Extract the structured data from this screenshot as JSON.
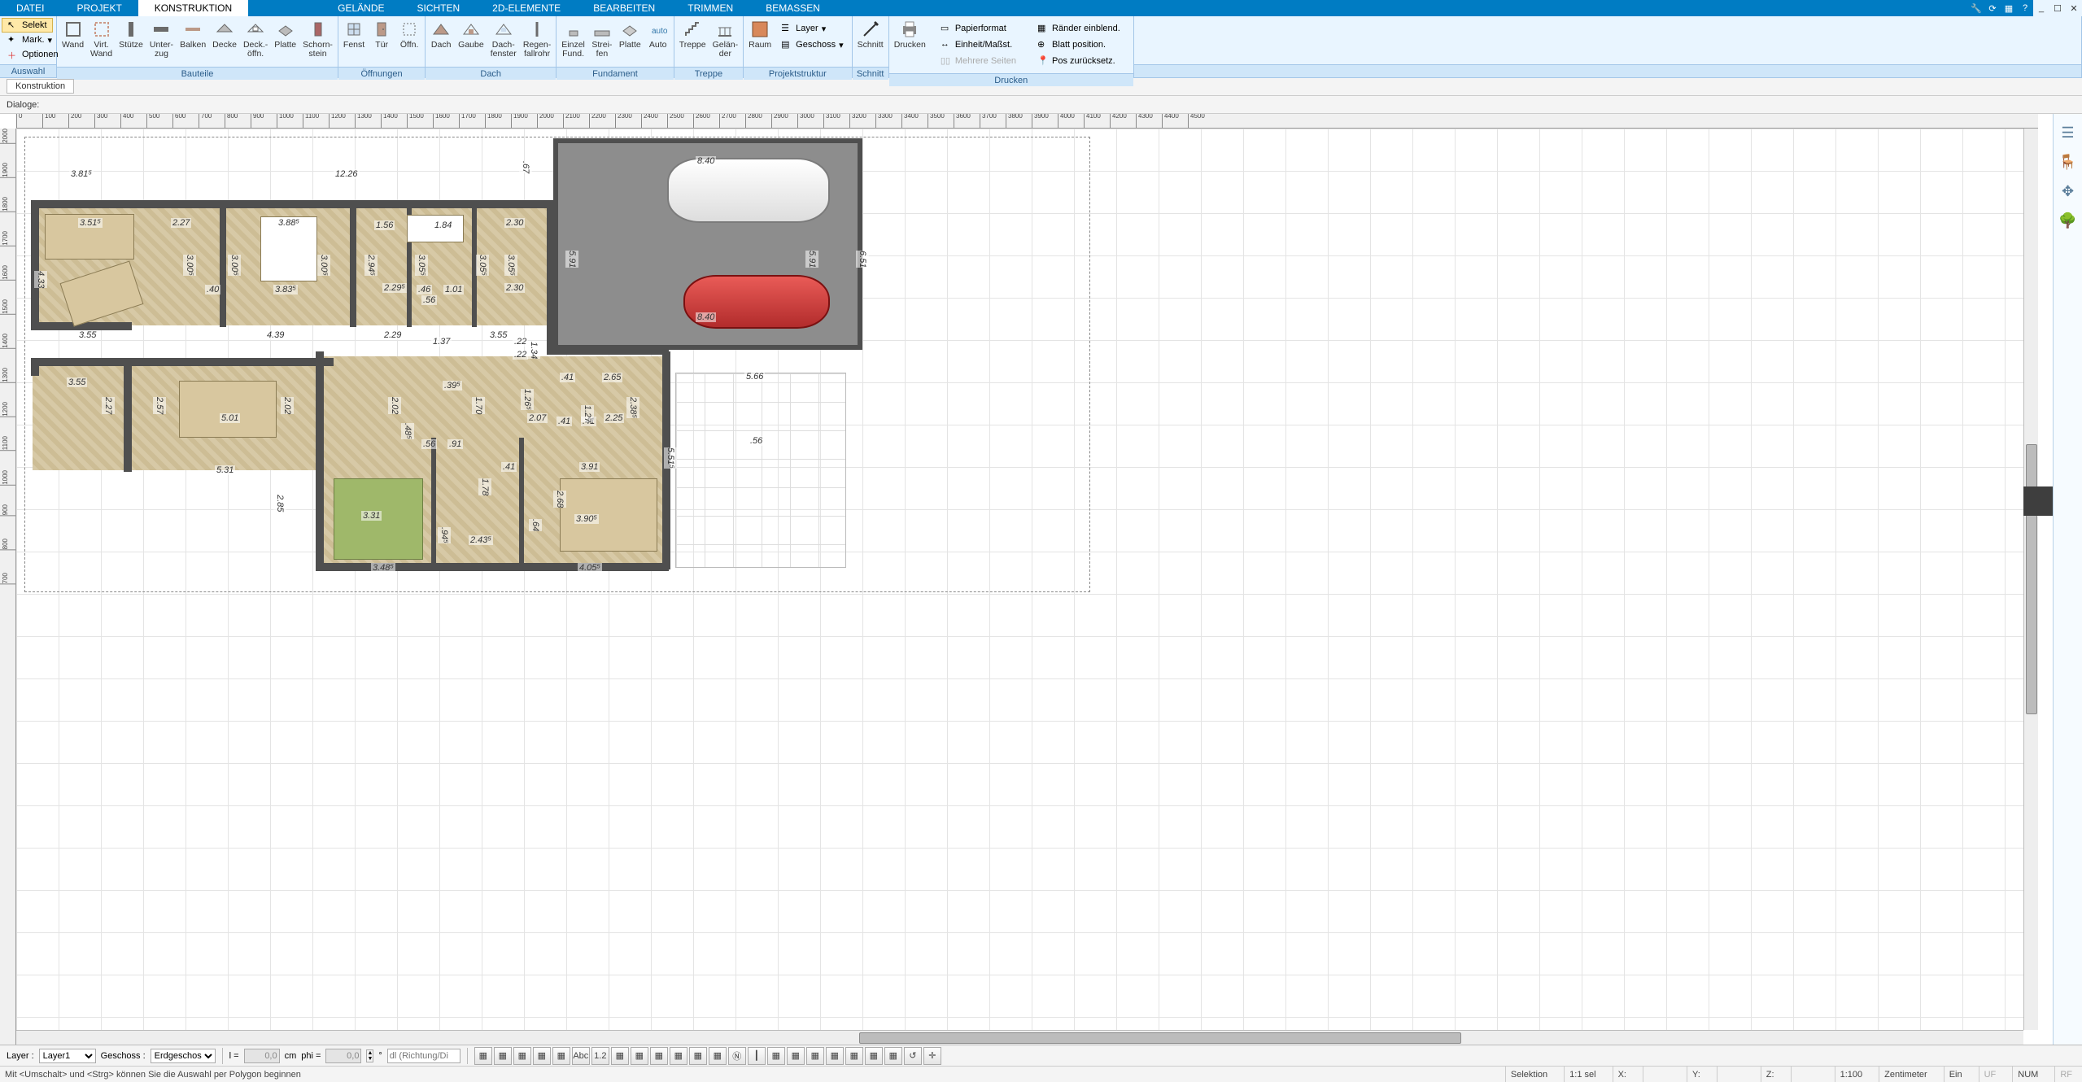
{
  "menu": {
    "items": [
      "DATEI",
      "PROJEKT",
      "KONSTRUKTION",
      "",
      "GELÄNDE",
      "SICHTEN",
      "2D-ELEMENTE",
      "BEARBEITEN",
      "TRIMMEN",
      "BEMASSEN"
    ],
    "active": 2
  },
  "win": {
    "icons": [
      "wrench",
      "refresh",
      "view",
      "help",
      "min",
      "max",
      "close"
    ]
  },
  "ribbon": {
    "selection": {
      "selekt": "Selekt",
      "mark": "Mark.",
      "optionen": "Optionen",
      "group": "Auswahl"
    },
    "bauteile": {
      "group": "Bauteile",
      "tools": [
        {
          "n": "wand",
          "l": "Wand"
        },
        {
          "n": "virt-wand",
          "l": "Virt.\nWand"
        },
        {
          "n": "stuetze",
          "l": "Stütze"
        },
        {
          "n": "unterzug",
          "l": "Unter-\nzug"
        },
        {
          "n": "balken",
          "l": "Balken"
        },
        {
          "n": "decke",
          "l": "Decke"
        },
        {
          "n": "deckoeffn",
          "l": "Deck.-\nöffn."
        },
        {
          "n": "platte",
          "l": "Platte"
        },
        {
          "n": "schornstein",
          "l": "Schorn-\nstein"
        }
      ]
    },
    "oeffnungen": {
      "group": "Öffnungen",
      "tools": [
        {
          "n": "fenst",
          "l": "Fenst"
        },
        {
          "n": "tuer",
          "l": "Tür"
        },
        {
          "n": "oeffn",
          "l": "Öffn."
        }
      ]
    },
    "dach": {
      "group": "Dach",
      "tools": [
        {
          "n": "dach",
          "l": "Dach"
        },
        {
          "n": "gaube",
          "l": "Gaube"
        },
        {
          "n": "dachfenster",
          "l": "Dach-\nfenster"
        },
        {
          "n": "regenfallrohr",
          "l": "Regen-\nfallrohr"
        }
      ]
    },
    "fundament": {
      "group": "Fundament",
      "tools": [
        {
          "n": "einzelfund",
          "l": "Einzel\nFund."
        },
        {
          "n": "streifen",
          "l": "Strei-\nfen"
        },
        {
          "n": "platte2",
          "l": "Platte"
        },
        {
          "n": "auto",
          "l": "Auto"
        }
      ]
    },
    "treppe": {
      "group": "Treppe",
      "tools": [
        {
          "n": "treppe",
          "l": "Treppe"
        },
        {
          "n": "gelaender",
          "l": "Gelän-\nder"
        }
      ]
    },
    "projektstruktur": {
      "group": "Projektstruktur",
      "tools": [
        {
          "n": "raum",
          "l": "Raum"
        }
      ],
      "drops": [
        {
          "n": "layer",
          "l": "Layer"
        },
        {
          "n": "geschoss",
          "l": "Geschoss"
        }
      ]
    },
    "schnitt": {
      "group": "Schnitt",
      "tools": [
        {
          "n": "schnitt",
          "l": "Schnitt"
        }
      ]
    },
    "drucken": {
      "group": "Drucken",
      "tools": [
        {
          "n": "drucken",
          "l": "Drucken"
        }
      ],
      "links": [
        {
          "n": "papierformat",
          "l": "Papierformat"
        },
        {
          "n": "raender",
          "l": "Ränder einblend."
        },
        {
          "n": "einheit",
          "l": "Einheit/Maßst."
        },
        {
          "n": "blattpos",
          "l": "Blatt position."
        },
        {
          "n": "mehrere",
          "l": "Mehrere Seiten"
        },
        {
          "n": "posreset",
          "l": "Pos zurücksetz."
        }
      ]
    }
  },
  "subbar1": {
    "tab": "Konstruktion"
  },
  "subbar2": {
    "label": "Dialoge:"
  },
  "rulerH": [
    0,
    100,
    200,
    300,
    400,
    500,
    600,
    700,
    800,
    900,
    1000,
    1100,
    1200,
    1300,
    1400,
    1500,
    1600,
    1700,
    1800,
    1900,
    2000,
    2100,
    2200,
    2300,
    2400,
    2500,
    2600,
    2700,
    2800,
    2900,
    3000,
    3100,
    3200,
    3300,
    3400,
    3500,
    3600,
    3700,
    3800,
    3900,
    4000,
    4100,
    4200,
    4300,
    4400,
    4500
  ],
  "rulerV": [
    2000,
    1900,
    1800,
    1700,
    1600,
    1500,
    1400,
    1300,
    1200,
    1100,
    1000,
    900,
    800,
    700
  ],
  "dims": {
    "d3_81": "3.81⁵",
    "d12_26": "12.26",
    "d0_67": ".67",
    "d8_40a": "8.40",
    "d8_40b": "8.40",
    "d3_51": "3.51⁵",
    "d2_27": "2.27",
    "d3_88": "3.88⁵",
    "d1_56": "1.56",
    "d1_84": "1.84",
    "d2_30a": "2.30",
    "d5_91": "5.91",
    "d5_91b": "5.91",
    "d6_51": "6.51",
    "d4_33": "4.33",
    "d3_00a": "3.00⁵",
    "d3_00b": "3.00⁵",
    "d3_00c": "3.00⁵",
    "d2_94": "2.94⁵",
    "d3_05a": "3.05⁵",
    "d3_05b": "3.05⁵",
    "d3_05c": "3.05⁵",
    "d0_40": ".40",
    "d3_83": "3.83⁵",
    "d2_29": "2.29⁵",
    "d0_46": ".46",
    "d1_01": "1.01",
    "d0_56": ".56",
    "d2_30b": "2.30",
    "d3_55a": "3.55",
    "d4_39": "4.39",
    "d2_29b": "2.29",
    "d1_37": "1.37",
    "d3_55b": "3.55",
    "d1_34": "1.34",
    "d0_22a": ".22",
    "d0_22b": ".22",
    "d3_55c": "3.55",
    "d5_66": "5.66",
    "d2_27b": "2.27",
    "d2_57": "2.57",
    "d5_01": "5.01",
    "d2_02a": "2.02",
    "d2_02b": "2.02",
    "d1_70": "1.70",
    "d0_395": ".39⁵",
    "d1_26": "1.26⁵",
    "d0_41a": ".41",
    "d2_65": "2.65",
    "d2_07": "2.07",
    "d2_25": "2.25",
    "d0_41b": ".41",
    "d0_41c": ".41",
    "d1_27": "1.27",
    "d2_38": "2.38⁵",
    "d5_31": "5.31",
    "d0_56b": ".56",
    "d0_91": ".91",
    "d0_485": ".48⁵",
    "d0_41d": ".41",
    "d3_91": "3.91",
    "d5_51": "5.51⁵",
    "d2_85": "2.85",
    "d3_31": "3.31",
    "d1_78": "1.78",
    "d2_68": "2.68",
    "d3_90": "3.90⁵",
    "d0_64": ".64",
    "d3_48": "3.48⁵",
    "d2_435": "2.43⁵",
    "d0_945": ".94⁵",
    "d4_05": "4.05⁵",
    "d0_56c": ".56"
  },
  "rpalette": [
    "layers",
    "chair",
    "snap",
    "tree"
  ],
  "bbar": {
    "layerLbl": "Layer :",
    "layerVal": "Layer1",
    "geschossLbl": "Geschoss :",
    "geschossVal": "Erdgeschoss",
    "lLbl": "l =",
    "lVal": "0,0",
    "lUnit": "cm",
    "phiLbl": "phi =",
    "phiVal": "0,0",
    "phiUnit": "°",
    "dlHint": "dl (Richtung/Di",
    "tbtns": [
      "hatch",
      "half",
      "center",
      "left-align",
      "dim-style",
      "abc",
      "dim12",
      "bracket",
      "rect",
      "rect2",
      "para1",
      "para2",
      "para3",
      "circle-n",
      "vline",
      "grid1",
      "grid2",
      "grid3",
      "grid4",
      "grid5",
      "grid6",
      "checker",
      "reset",
      "target"
    ]
  },
  "status": {
    "hint": "Mit <Umschalt> und <Strg> können Sie die Auswahl per Polygon beginnen",
    "mode": "Selektion",
    "sel": "1:1 sel",
    "x": "X:",
    "y": "Y:",
    "z": "Z:",
    "scale": "1:100",
    "unit": "Zentimeter",
    "flags": [
      "Ein",
      "UF",
      "NUM",
      "RF"
    ]
  }
}
